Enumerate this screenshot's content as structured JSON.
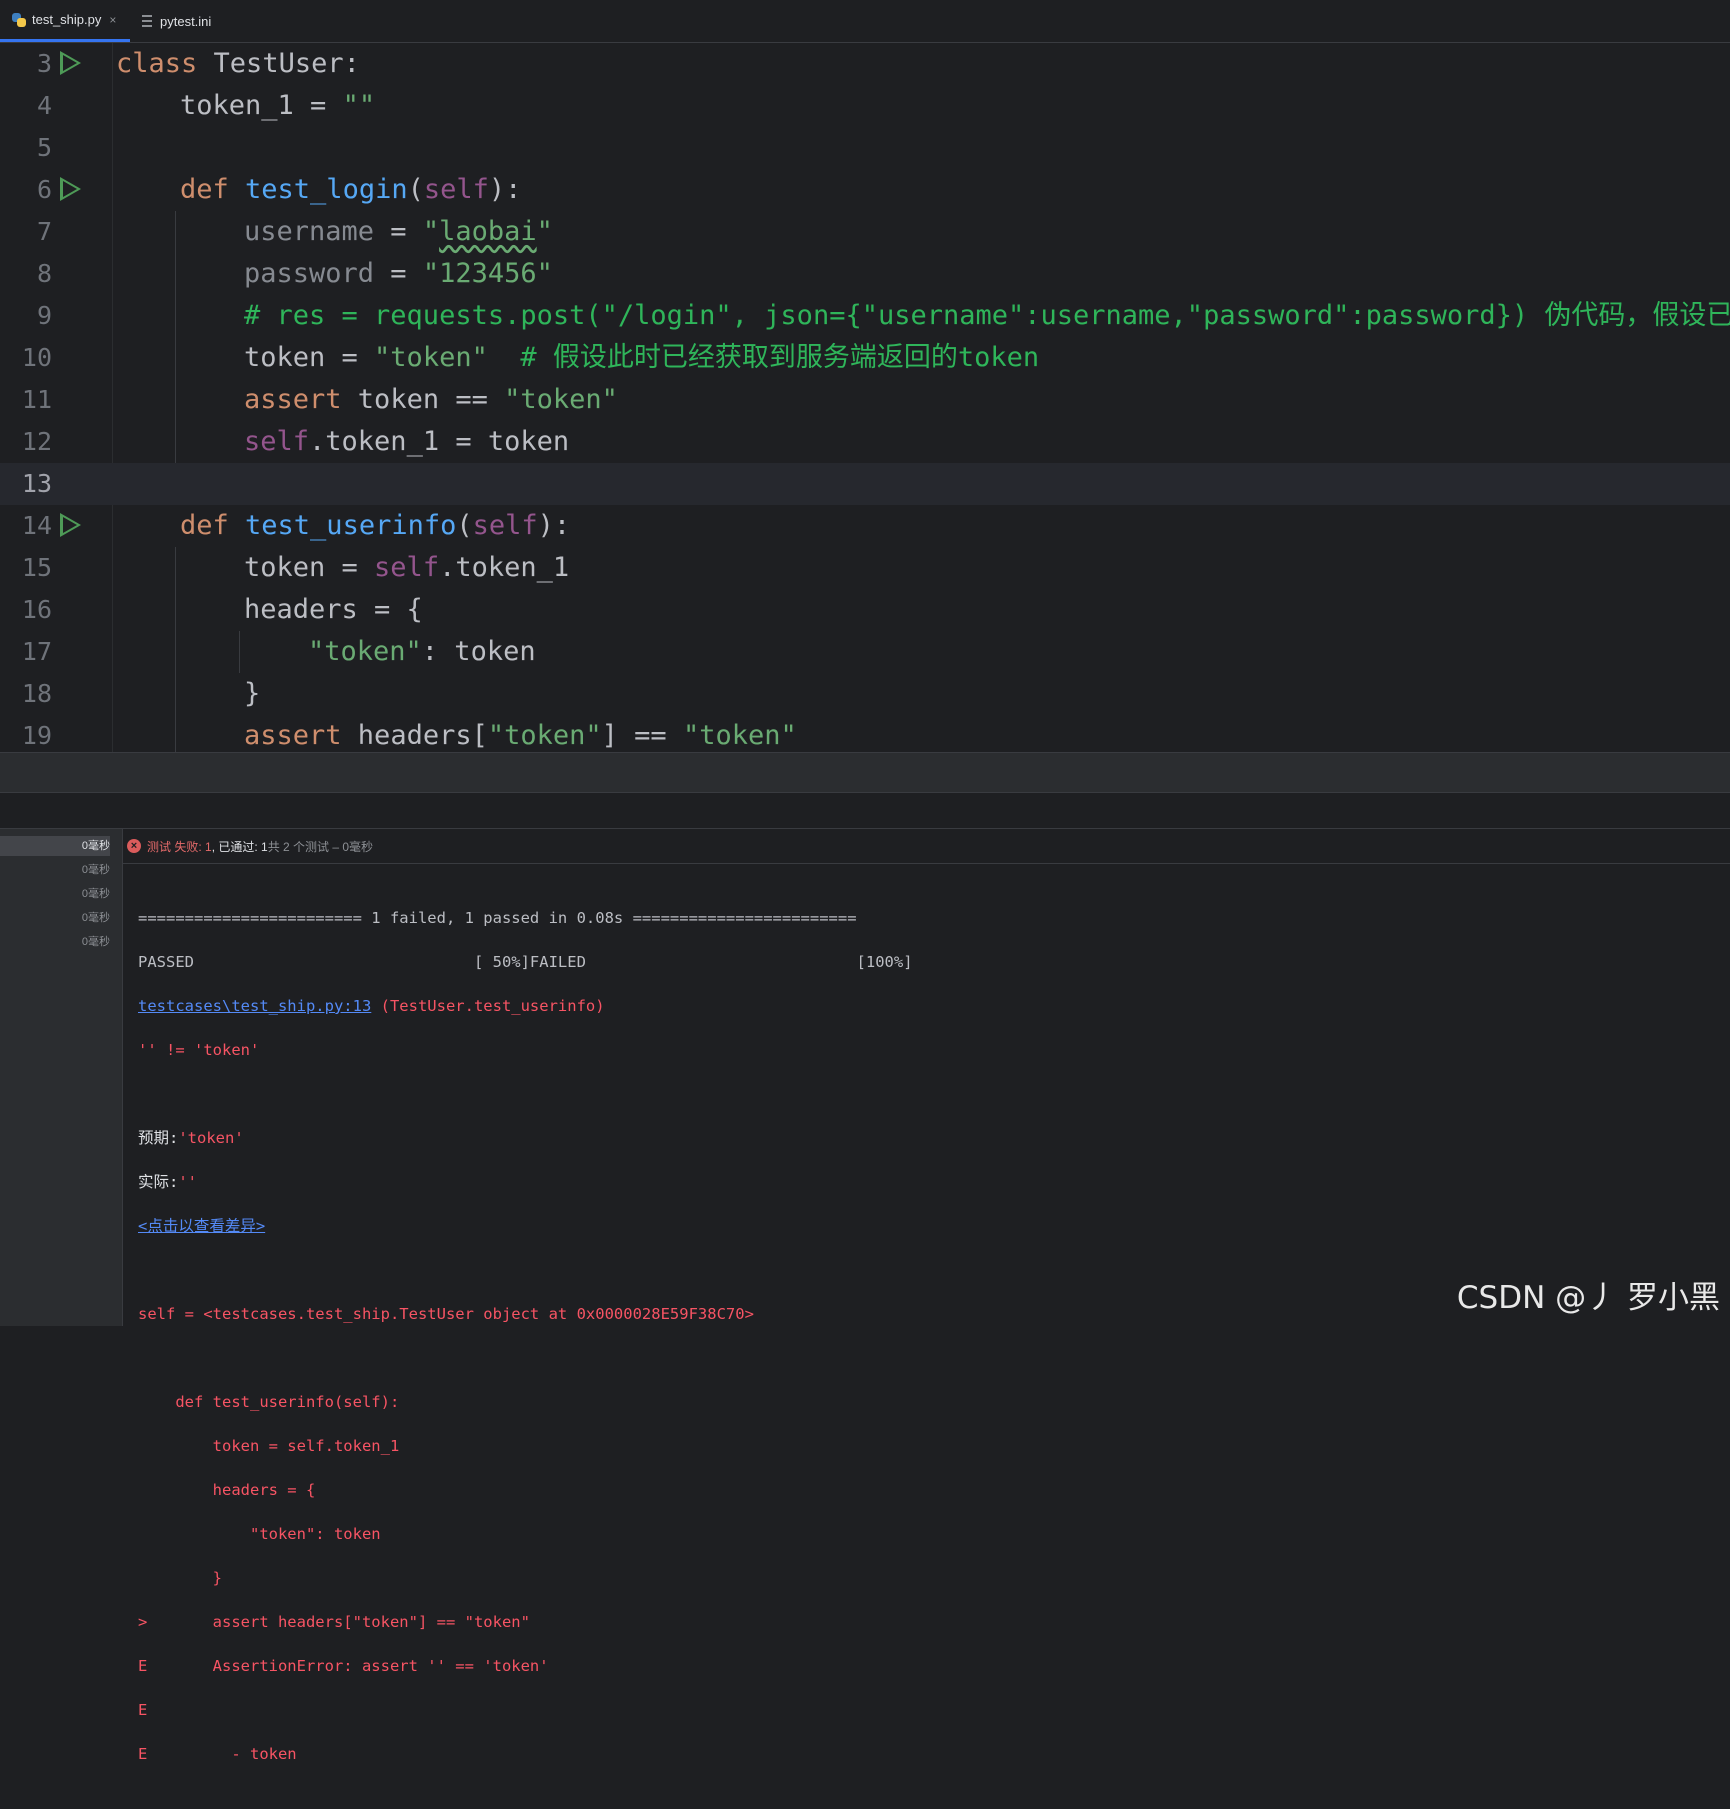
{
  "tabs": [
    {
      "label": "test_ship.py",
      "active": true,
      "close": "×"
    },
    {
      "label": "pytest.ini",
      "active": false
    }
  ],
  "editor": {
    "lines": [
      {
        "num": "3"
      },
      {
        "num": "4"
      },
      {
        "num": "5"
      },
      {
        "num": "6"
      },
      {
        "num": "7"
      },
      {
        "num": "8"
      },
      {
        "num": "9"
      },
      {
        "num": "10"
      },
      {
        "num": "11"
      },
      {
        "num": "12"
      },
      {
        "num": "13"
      },
      {
        "num": "14"
      },
      {
        "num": "15"
      },
      {
        "num": "16"
      },
      {
        "num": "17"
      },
      {
        "num": "18"
      },
      {
        "num": "19"
      }
    ],
    "code": {
      "l3_kw": "class ",
      "l3_name": "TestUser:",
      "l4": "token_1 = ",
      "l4_str": "\"\"",
      "l6_kw": "def ",
      "l6_fn": "test_login",
      "l6_p1": "(",
      "l6_self": "self",
      "l6_p2": "):",
      "l7_var": "username",
      "l7_eq": " = ",
      "l7_q1": "\"",
      "l7_val": "laobai",
      "l7_q2": "\"",
      "l8_var": "password",
      "l8_eq": " = ",
      "l8_str": "\"123456\"",
      "l9_cmt": "# res = requests.post(\"/login\", json={\"username\":username,\"password\":password}) 伪代码，假设已经",
      "l10": "token = ",
      "l10_str": "\"token\"",
      "l10_cmt": "  # 假设此时已经获取到服务端返回的token",
      "l11_kw": "assert",
      "l11": " token == ",
      "l11_str": "\"token\"",
      "l12_self": "self",
      "l12": ".token_1 = token",
      "l14_kw": "def ",
      "l14_fn": "test_userinfo",
      "l14_p1": "(",
      "l14_self": "self",
      "l14_p2": "):",
      "l15": "token = ",
      "l15_self": "self",
      "l15_b": ".token_1",
      "l16": "headers = {",
      "l17_str": "\"token\"",
      "l17": ": token",
      "l18": "}",
      "l19_kw": "assert",
      "l19": " headers[",
      "l19_str": "\"token\"",
      "l19_b": "] == ",
      "l19_str2": "\"token\""
    }
  },
  "tree": {
    "times": [
      "0毫秒",
      "0毫秒",
      "0毫秒",
      "0毫秒",
      "0毫秒"
    ]
  },
  "test_header": {
    "fail_label": "测试 失败: 1",
    "pass_label": ", 已通过: 1",
    "total_label": "共 2 个测试 – 0毫秒"
  },
  "console": {
    "l1": "======================== 1 failed, 1 passed in 0.08s ========================",
    "l2": "PASSED                              [ 50%]FAILED                             [100%]",
    "l3_link": "testcases\\test_ship.py:13",
    "l3_rest": " (TestUser.test_userinfo)",
    "l4": "'' != 'token'",
    "l6_label": "预期:",
    "l6_val": "'token'",
    "l7_label": "实际:",
    "l7_val": "''",
    "l8_link": "<点击以查看差异>",
    "l10": "self = <testcases.test_ship.TestUser object at 0x0000028E59F38C70>",
    "l12": "    def test_userinfo(self):",
    "l13": "        token = self.token_1",
    "l14": "        headers = {",
    "l15": "            \"token\": token",
    "l16": "        }",
    "l17": ">       assert headers[\"token\"] == \"token\"",
    "l18": "E       AssertionError: assert '' == 'token'",
    "l19": "E",
    "l20": "E         - token"
  },
  "watermark": "CSDN @丿 罗小黑"
}
